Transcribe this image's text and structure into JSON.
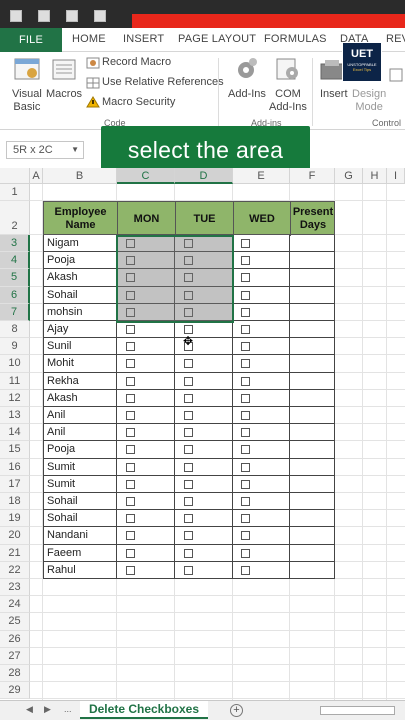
{
  "ribbon": {
    "tabs": [
      "FILE",
      "HOME",
      "INSERT",
      "PAGE LAYOUT",
      "FORMULAS",
      "DATA",
      "REV"
    ],
    "code_group": {
      "visual_basic": [
        "Visual",
        "Basic"
      ],
      "macros": "Macros",
      "record_macro": "Record Macro",
      "relative_refs": "Use Relative References",
      "macro_security": "Macro Security",
      "label": "Code"
    },
    "addins_group": {
      "addins": "Add-Ins",
      "com_addins": [
        "COM",
        "Add-Ins"
      ],
      "label": "Add-ins"
    },
    "controls_group": {
      "insert": "Insert",
      "design_mode": [
        "Design",
        "Mode"
      ],
      "label": "Control"
    }
  },
  "namebox": {
    "value": "5R x 2C"
  },
  "caption": "select the area",
  "logo": {
    "main": "UET",
    "line1": "UNSTOPPABLE",
    "line2": "Excel Tips"
  },
  "columns": [
    "A",
    "B",
    "C",
    "D",
    "E",
    "F",
    "G",
    "H",
    "I"
  ],
  "rows": [
    "1",
    "2",
    "3",
    "4",
    "5",
    "6",
    "7",
    "8",
    "9",
    "10",
    "11",
    "12",
    "13",
    "14",
    "15",
    "16",
    "17",
    "18",
    "19",
    "20",
    "21",
    "22",
    "23",
    "24",
    "25",
    "26",
    "27",
    "28",
    "29"
  ],
  "table": {
    "headers": {
      "name": [
        "Employee",
        "Name"
      ],
      "mon": "MON",
      "tue": "TUE",
      "wed": "WED",
      "present": [
        "Present",
        "Days"
      ]
    },
    "employees": [
      "Nigam",
      "Pooja",
      "Akash",
      "Sohail",
      "mohsin",
      "Ajay",
      "Sunil",
      "Mohit",
      "Rekha",
      "Akash",
      "Anil",
      "Anil",
      "Pooja",
      "Sumit",
      "Sumit",
      "Sohail",
      "Sohail",
      "Nandani",
      "Faeem",
      "Rahul"
    ]
  },
  "selection": {
    "start_row": "3",
    "end_row": "7",
    "columns": [
      "C",
      "D"
    ]
  },
  "sheet_tab": {
    "name": "Delete Checkboxes",
    "nav": [
      "◀",
      "▶",
      "..."
    ],
    "add": "+"
  },
  "colors": {
    "excel_green": "#217346",
    "header_fill": "#8fb56a",
    "caption_bg": "#167a3c",
    "accent_red": "#e8271b"
  }
}
